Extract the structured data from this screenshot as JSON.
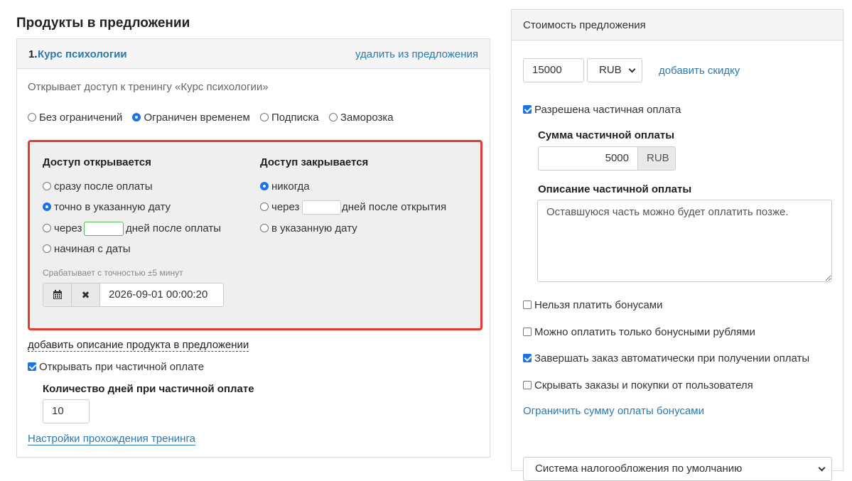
{
  "left": {
    "section_title": "Продукты в предложении",
    "product": {
      "number": "1.",
      "name": "Курс психологии",
      "remove_link": "удалить из предложения",
      "description": "Открывает доступ к тренингу «Курс психологии»"
    },
    "access_types": [
      {
        "label": "Без ограничений",
        "selected": false
      },
      {
        "label": "Ограничен временем",
        "selected": true
      },
      {
        "label": "Подписка",
        "selected": false
      },
      {
        "label": "Заморозка",
        "selected": false
      }
    ],
    "access_opens": {
      "heading": "Доступ открывается",
      "options": {
        "immediately": "сразу после оплаты",
        "exact_date": "точно в указанную дату",
        "after_prefix": "через",
        "after_suffix": "дней после оплаты",
        "from_date": "начиная с даты"
      },
      "accuracy_note": "Срабатывает с точностью ±5 минут",
      "date_value": "2026-09-01 00:00:20"
    },
    "access_closes": {
      "heading": "Доступ закрывается",
      "options": {
        "never": "никогда",
        "after_prefix": "через",
        "after_suffix": "дней после открытия",
        "on_date": "в указанную дату"
      }
    },
    "add_description_link": "добавить описание продукта в предложении",
    "open_on_partial_label": "Открывать при частичной оплате",
    "partial_days_label": "Количество дней при частичной оплате",
    "partial_days_value": "10",
    "training_settings_link": "Настройки прохождения тренинга"
  },
  "right": {
    "panel_title": "Стоимость предложения",
    "price_value": "15000",
    "currency": "RUB",
    "add_discount_link": "добавить скидку",
    "partial_allowed_label": "Разрешена частичная оплата",
    "partial_sum_label": "Сумма частичной оплаты",
    "partial_sum_value": "5000",
    "partial_sum_currency": "RUB",
    "partial_desc_label": "Описание частичной оплаты",
    "partial_desc_value": "Оставшуюся часть можно будет оплатить позже.",
    "checkboxes": {
      "no_bonus": "Нельзя платить бонусами",
      "only_bonus": "Можно оплатить только бонусными рублями",
      "auto_complete": "Завершать заказ автоматически при получении оплаты",
      "hide_orders": "Скрывать заказы и покупки от пользователя"
    },
    "limit_bonus_link": "Ограничить сумму оплаты бонусами",
    "tax_system": "Система налогообложения по умолчанию"
  }
}
